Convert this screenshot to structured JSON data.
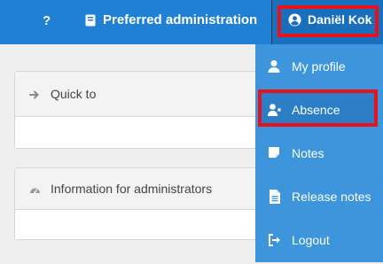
{
  "topbar": {
    "help_label": "?",
    "preferred_label": "Preferred administration",
    "user_label": "Daniël Kok"
  },
  "cards": [
    {
      "title": "Quick to"
    },
    {
      "title": "Information for administrators"
    }
  ],
  "menu": {
    "items": [
      {
        "label": "My profile",
        "icon": "person-icon"
      },
      {
        "label": "Absence",
        "icon": "person-absent-icon"
      },
      {
        "label": "Notes",
        "icon": "note-icon"
      },
      {
        "label": "Release notes",
        "icon": "document-icon"
      },
      {
        "label": "Logout",
        "icon": "logout-icon"
      }
    ]
  },
  "colors": {
    "topbar": "#1f80d4",
    "dropdown": "#3d96dc",
    "highlight": "#e8101a"
  }
}
